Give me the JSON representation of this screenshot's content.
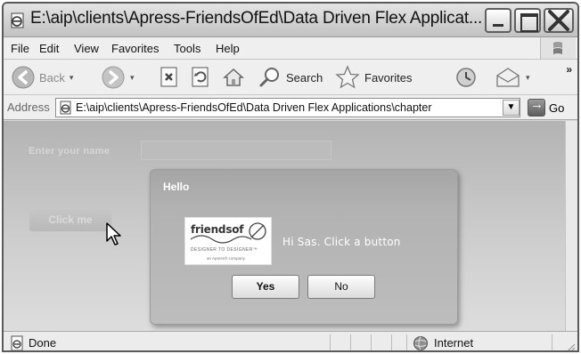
{
  "window": {
    "title": "E:\\aip\\clients\\Apress-FriendsOfEd\\Data Driven Flex Applicat..."
  },
  "menu": {
    "items": [
      "File",
      "Edit",
      "View",
      "Favorites",
      "Tools",
      "Help"
    ]
  },
  "toolbar": {
    "back_label": "Back",
    "search_label": "Search",
    "favorites_label": "Favorites"
  },
  "address": {
    "label": "Address",
    "url": "E:\\aip\\clients\\Apress-FriendsOfEd\\Data Driven Flex Applications\\chapter",
    "go_label": "Go"
  },
  "app": {
    "name_label": "Enter your name",
    "name_value": "",
    "button_label": "Click me"
  },
  "dialog": {
    "title": "Hello",
    "message": "Hi Sas. Click a button",
    "yes_label": "Yes",
    "no_label": "No",
    "logo_text": "friendsof",
    "logo_tagline": "DESIGNER TO DESIGNER™",
    "logo_subtext": "an Apress® company"
  },
  "status": {
    "text": "Done",
    "zone": "Internet"
  },
  "icons": {
    "title": "ie-page-icon",
    "back": "back-arrow-icon",
    "forward": "forward-arrow-icon",
    "stop": "stop-icon",
    "refresh": "refresh-icon",
    "home": "home-icon",
    "search": "search-icon",
    "favorites": "favorites-star-icon",
    "history": "history-icon",
    "mail": "mail-icon",
    "go": "go-arrow-icon",
    "zone": "internet-zone-icon"
  }
}
